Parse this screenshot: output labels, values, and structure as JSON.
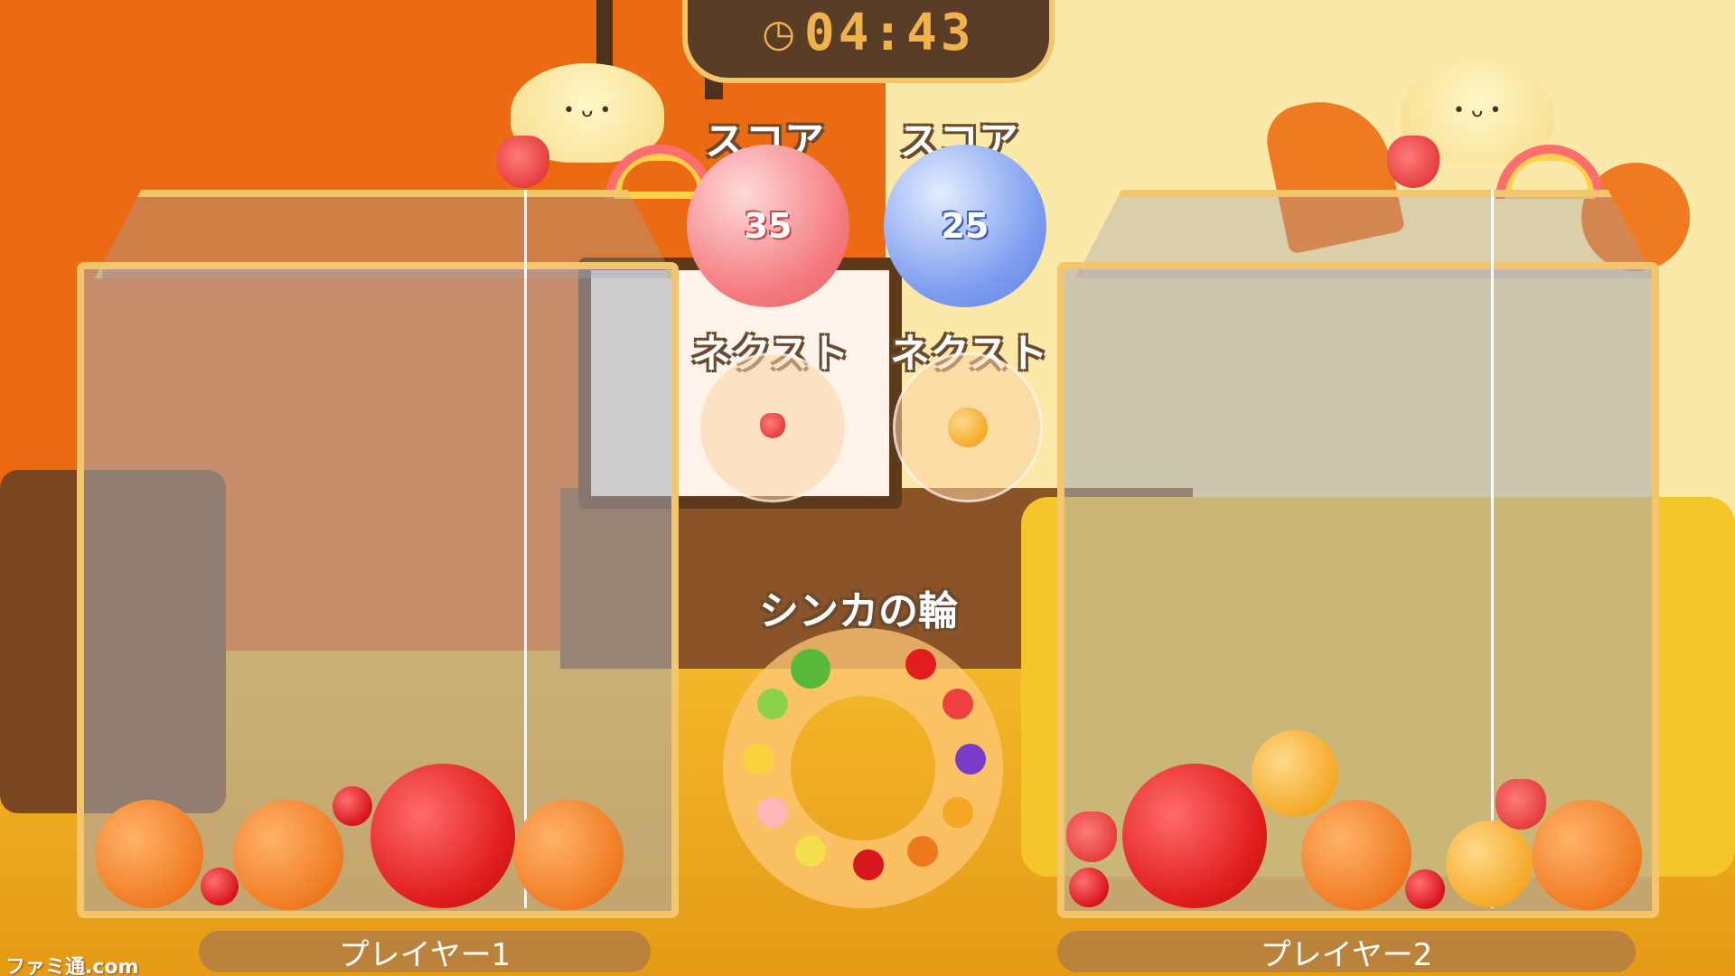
{
  "timer": {
    "icon": "clock-icon",
    "text": "04:43"
  },
  "players": [
    {
      "score_label": "スコア",
      "score": "35",
      "next_label": "ネクスト",
      "next_fruit": "strawberry",
      "name": "プレイヤー1",
      "color": "#f47b80"
    },
    {
      "score_label": "スコア",
      "score": "25",
      "next_label": "ネクスト",
      "next_fruit": "dekopon",
      "name": "プレイヤー2",
      "color": "#7c9cef"
    }
  ],
  "evolution_ring": {
    "title": "シンカの輪",
    "fruits": [
      "cherry",
      "strawberry",
      "grape",
      "dekopon",
      "persimmon",
      "apple",
      "pear",
      "peach",
      "pineapple",
      "melon",
      "watermelon"
    ]
  },
  "watermark": "ファミ通.com",
  "colors": {
    "wall_orange": "#ec6a12",
    "wall_cream": "#fbe9a9",
    "frame_gold": "#f3c56c",
    "timer_brown": "#5a3d26"
  }
}
